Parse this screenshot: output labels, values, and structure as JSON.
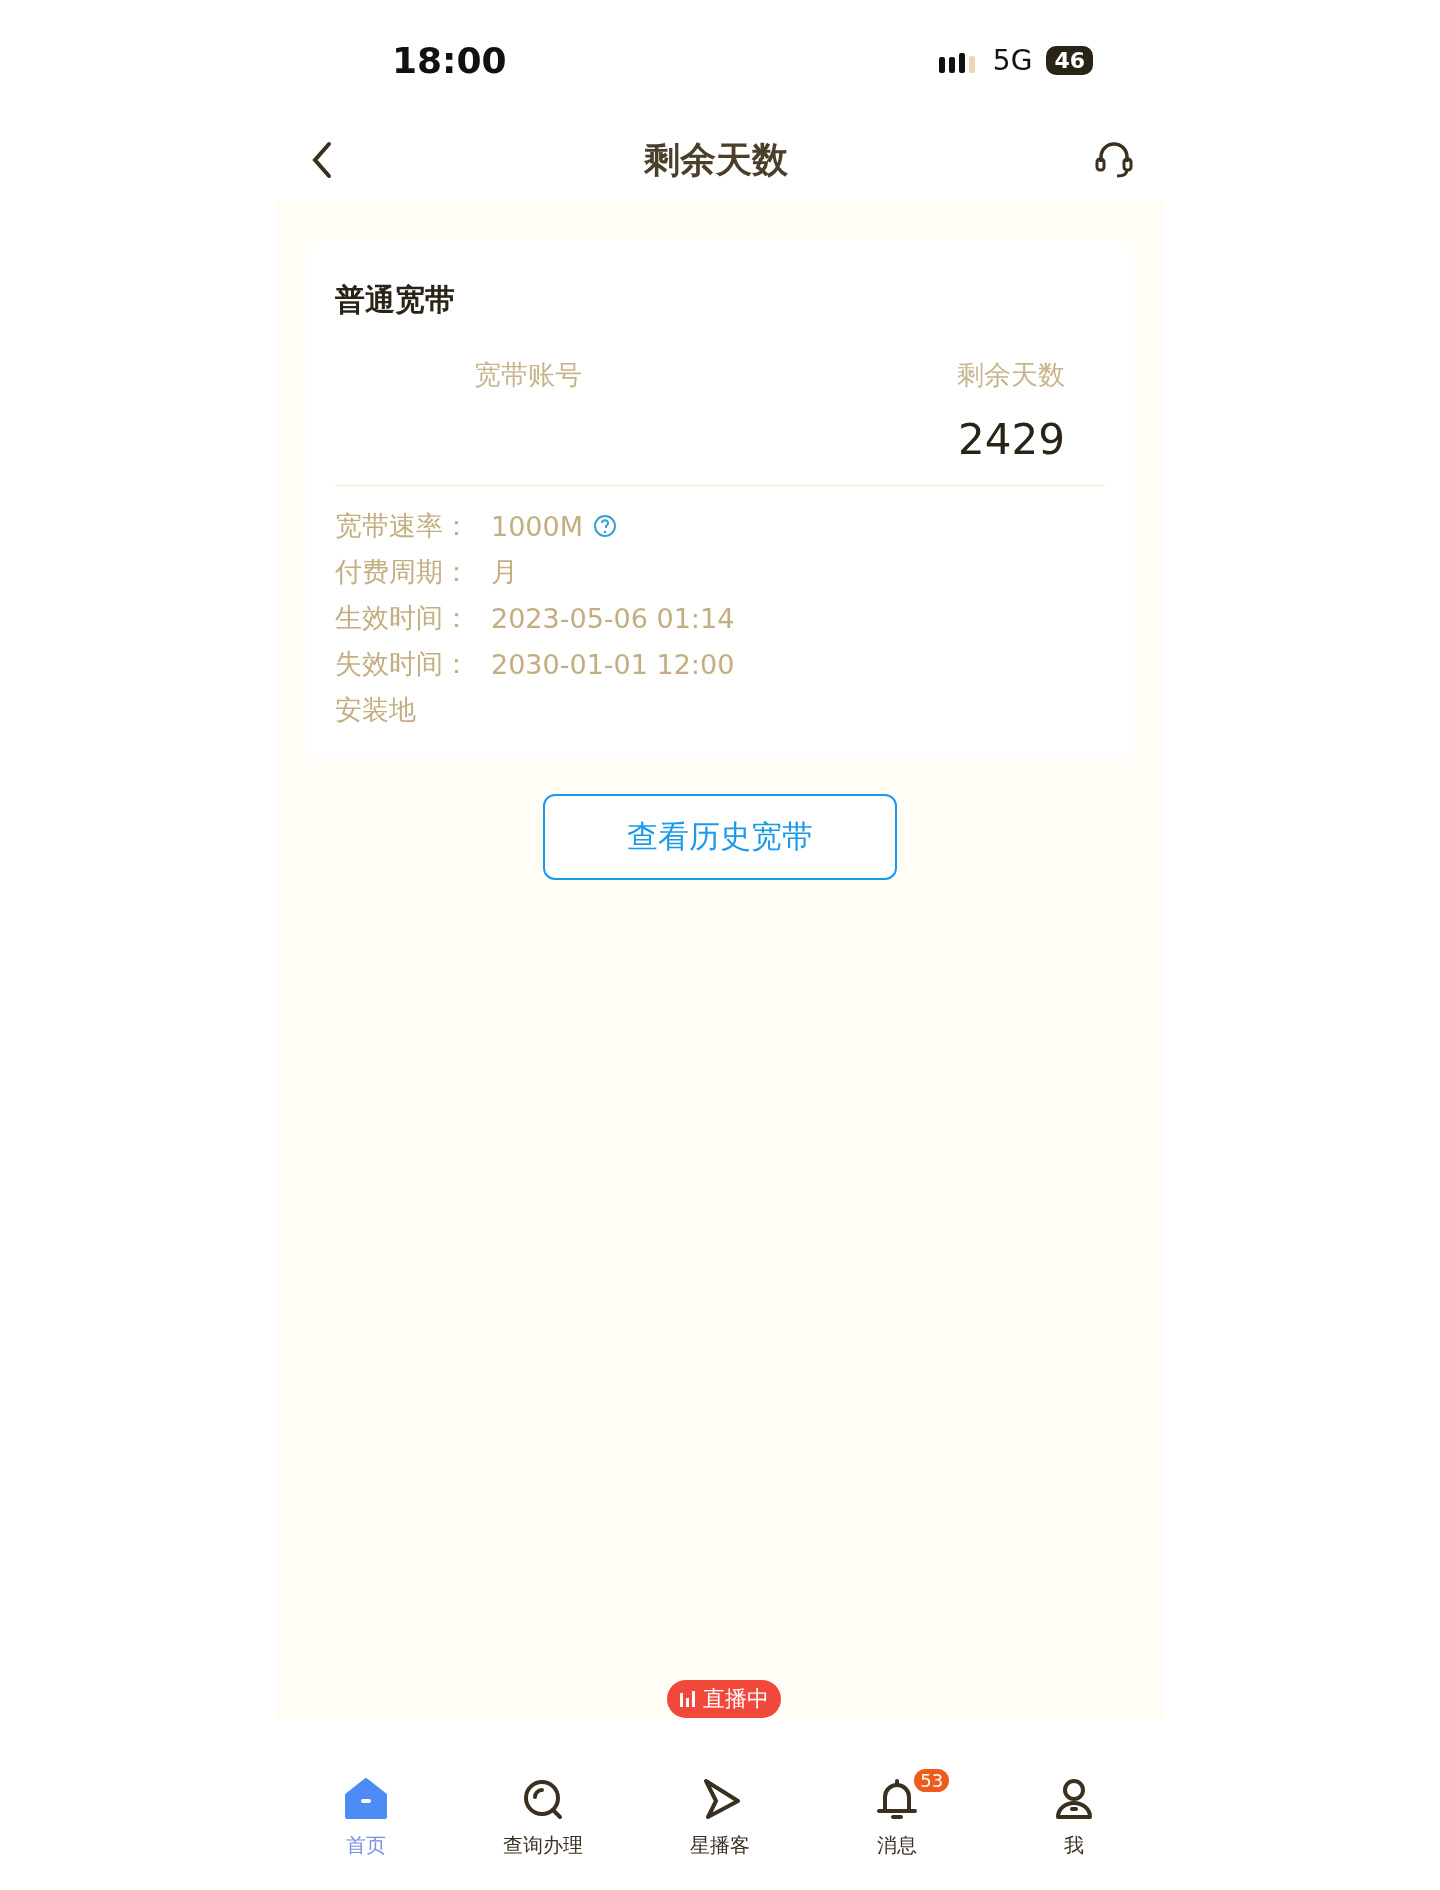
{
  "status_bar": {
    "time": "18:00",
    "network": "5G",
    "battery": "46"
  },
  "nav": {
    "title": "剩余天数"
  },
  "card": {
    "title": "普通宽带",
    "columns": [
      {
        "header": "宽带账号"
      },
      {
        "header": "剩余天数",
        "value": "2429"
      }
    ],
    "details": [
      {
        "label": "宽带速率：",
        "value": "1000M",
        "help": true
      },
      {
        "label": "付费周期：",
        "value": "月",
        "help": false
      },
      {
        "label": "生效时间：",
        "value": "2023-05-06 01:14",
        "help": false
      },
      {
        "label": "失效时间：",
        "value": "2030-01-01 12:00",
        "help": false
      }
    ],
    "address_label": "安装地"
  },
  "history_button": "查看历史宽带",
  "live_badge": "直播中",
  "tabs": [
    {
      "kind": "home",
      "label": "首页",
      "selected": true
    },
    {
      "kind": "search",
      "label": "查询办理",
      "selected": false
    },
    {
      "kind": "play",
      "label": "星播客",
      "selected": false
    },
    {
      "kind": "bell",
      "label": "消息",
      "selected": false,
      "badge": "53"
    },
    {
      "kind": "person",
      "label": "我",
      "selected": false
    }
  ]
}
